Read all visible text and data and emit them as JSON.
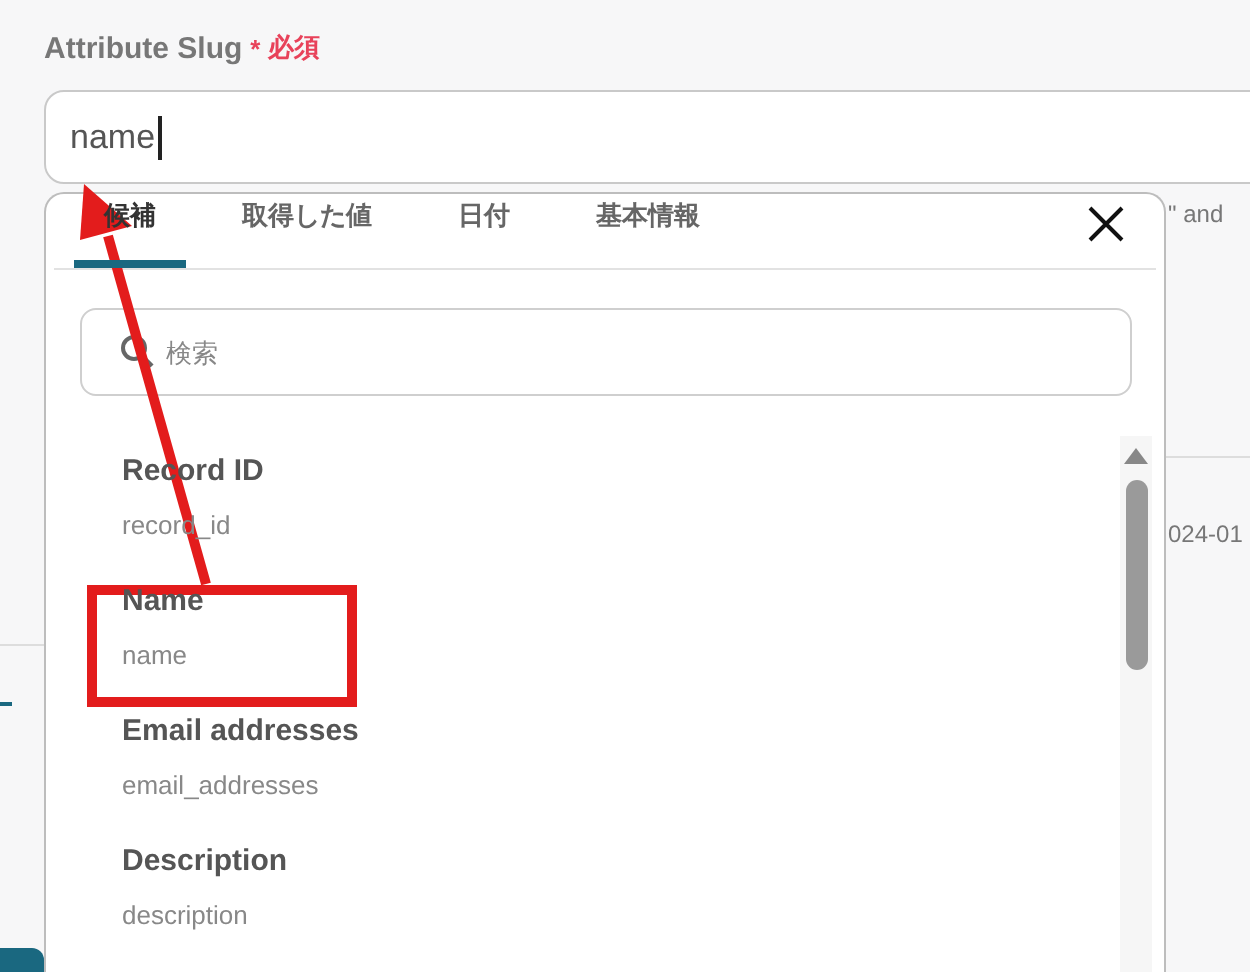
{
  "field": {
    "label": "Attribute Slug",
    "required_mark": "*",
    "required_text": "必須",
    "value": "name"
  },
  "background_texts": [
    "\" and",
    "024-01"
  ],
  "popup": {
    "tabs": [
      {
        "label": "候補",
        "selected": true
      },
      {
        "label": "取得した値",
        "selected": false
      },
      {
        "label": "日付",
        "selected": false
      },
      {
        "label": "基本情報",
        "selected": false
      }
    ],
    "search": {
      "placeholder": "検索"
    },
    "items": [
      {
        "title": "Record ID",
        "key": "record_id"
      },
      {
        "title": "Name",
        "key": "name"
      },
      {
        "title": "Email addresses",
        "key": "email_addresses"
      },
      {
        "title": "Description",
        "key": "description"
      }
    ]
  }
}
